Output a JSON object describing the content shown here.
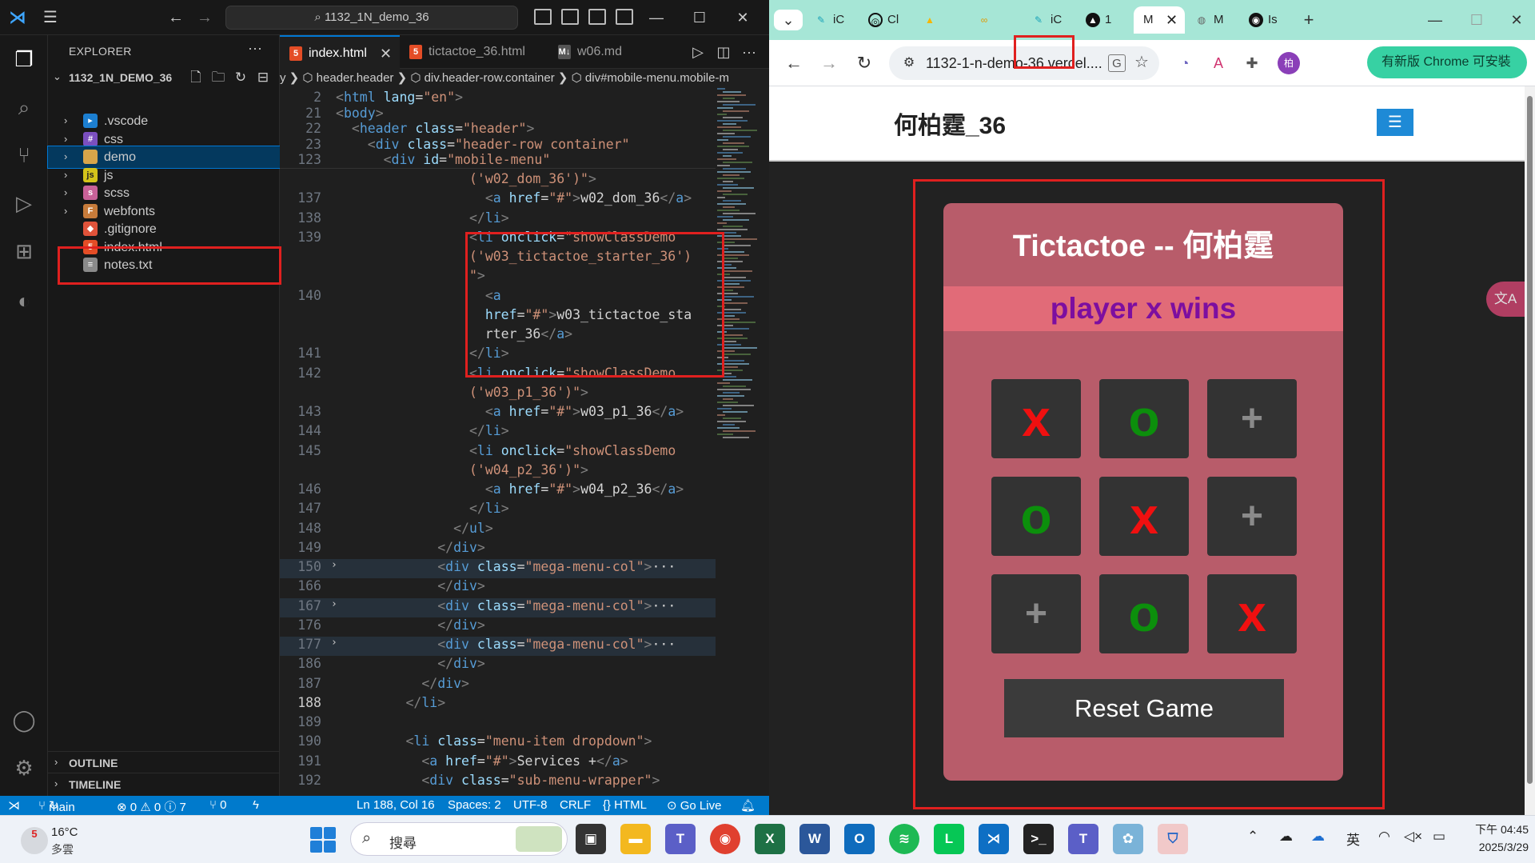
{
  "vscode": {
    "title_search": "1132_1N_demo_36",
    "explorer_label": "EXPLORER",
    "project_name": "1132_1N_DEMO_36",
    "tree": [
      {
        "label": ".vscode",
        "icon": "vscode-folder-icon",
        "folder": true
      },
      {
        "label": "css",
        "icon": "css-folder-icon",
        "folder": true
      },
      {
        "label": "demo",
        "icon": "folder-icon",
        "folder": true,
        "selected": true
      },
      {
        "label": "js",
        "icon": "js-folder-icon",
        "folder": true
      },
      {
        "label": "scss",
        "icon": "scss-folder-icon",
        "folder": true
      },
      {
        "label": "webfonts",
        "icon": "webfonts-folder-icon",
        "folder": true
      },
      {
        "label": ".gitignore",
        "icon": "git-icon",
        "folder": false
      },
      {
        "label": "index.html",
        "icon": "html-file-icon",
        "folder": false
      },
      {
        "label": "notes.txt",
        "icon": "text-file-icon",
        "folder": false
      }
    ],
    "outline_label": "OUTLINE",
    "timeline_label": "TIMELINE",
    "tabs": [
      {
        "label": "index.html",
        "active": true
      },
      {
        "label": "tictactoe_36.html",
        "active": false
      },
      {
        "label": "w06.md",
        "active": false
      }
    ],
    "breadcrumb": "y  ❯  ⬡ header.header  ❯  ⬡ div.header-row.container  ❯  ⬡ div#mobile-menu.mobile-m",
    "sticky_lines": [
      {
        "n": "2",
        "html": "<span class='br'>&lt;</span><span class='tag'>html</span> <span class='att'>lang</span>=<span class='str'>\"en\"</span><span class='br'>&gt;</span>"
      },
      {
        "n": "21",
        "html": "<span class='br'>&lt;</span><span class='tag'>body</span><span class='br'>&gt;</span>"
      },
      {
        "n": "22",
        "html": "  <span class='br'>&lt;</span><span class='tag'>header</span> <span class='att'>class</span>=<span class='str'>\"header\"</span><span class='br'>&gt;</span>"
      },
      {
        "n": "23",
        "html": "    <span class='br'>&lt;</span><span class='tag'>div</span> <span class='att'>class</span>=<span class='str'>\"header-row container\"</span>"
      },
      {
        "n": "123",
        "html": "      <span class='br'>&lt;</span><span class='tag'>div</span> <span class='att'>id</span>=<span class='str'>\"mobile-menu\"</span>"
      }
    ],
    "code_lines": [
      {
        "n": "",
        "html": "                <span class='str'>('w02_dom_36')\"</span><span class='br'>&gt;</span>"
      },
      {
        "n": "137",
        "html": "                  <span class='br'>&lt;</span><span class='tag'>a</span> <span class='att'>href</span>=<span class='str'>\"#\"</span><span class='br'>&gt;</span>w02_dom_36<span class='br'>&lt;/</span><span class='tag'>a</span><span class='br'>&gt;</span>"
      },
      {
        "n": "138",
        "html": "                <span class='br'>&lt;/</span><span class='tag'>li</span><span class='br'>&gt;</span>"
      },
      {
        "n": "139",
        "html": "                <span class='br'>&lt;</span><span class='tag'>li</span> <span class='att'>onclick</span>=<span class='str'>\"showClassDemo</span>"
      },
      {
        "n": "",
        "html": "                <span class='str'>('w03_tictactoe_starter_36')</span>"
      },
      {
        "n": "",
        "html": "                <span class='str'>\"</span><span class='br'>&gt;</span>"
      },
      {
        "n": "140",
        "html": "                  <span class='br'>&lt;</span><span class='tag'>a</span>"
      },
      {
        "n": "",
        "html": "                  <span class='att'>href</span>=<span class='str'>\"#\"</span><span class='br'>&gt;</span>w03_tictactoe_sta"
      },
      {
        "n": "",
        "html": "                  rter_36<span class='br'>&lt;/</span><span class='tag'>a</span><span class='br'>&gt;</span>"
      },
      {
        "n": "141",
        "html": "                <span class='br'>&lt;/</span><span class='tag'>li</span><span class='br'>&gt;</span>"
      },
      {
        "n": "142",
        "html": "                <span class='br'>&lt;</span><span class='tag'>li</span> <span class='att'>onclick</span>=<span class='str'>\"showClassDemo</span>"
      },
      {
        "n": "",
        "html": "                <span class='str'>('w03_p1_36')\"</span><span class='br'>&gt;</span>"
      },
      {
        "n": "143",
        "html": "                  <span class='br'>&lt;</span><span class='tag'>a</span> <span class='att'>href</span>=<span class='str'>\"#\"</span><span class='br'>&gt;</span>w03_p1_36<span class='br'>&lt;/</span><span class='tag'>a</span><span class='br'>&gt;</span>"
      },
      {
        "n": "144",
        "html": "                <span class='br'>&lt;/</span><span class='tag'>li</span><span class='br'>&gt;</span>"
      },
      {
        "n": "145",
        "html": "                <span class='br'>&lt;</span><span class='tag'>li</span> <span class='att'>onclick</span>=<span class='str'>\"showClassDemo</span>"
      },
      {
        "n": "",
        "html": "                <span class='str'>('w04_p2_36')\"</span><span class='br'>&gt;</span>"
      },
      {
        "n": "146",
        "html": "                  <span class='br'>&lt;</span><span class='tag'>a</span> <span class='att'>href</span>=<span class='str'>\"#\"</span><span class='br'>&gt;</span>w04_p2_36<span class='br'>&lt;/</span><span class='tag'>a</span><span class='br'>&gt;</span>"
      },
      {
        "n": "147",
        "html": "                <span class='br'>&lt;/</span><span class='tag'>li</span><span class='br'>&gt;</span>"
      },
      {
        "n": "148",
        "html": "              <span class='br'>&lt;/</span><span class='tag'>ul</span><span class='br'>&gt;</span>"
      },
      {
        "n": "149",
        "html": "            <span class='br'>&lt;/</span><span class='tag'>div</span><span class='br'>&gt;</span>"
      },
      {
        "n": "150",
        "fold": true,
        "html": "            <span class='br'>&lt;</span><span class='tag'>div</span> <span class='att'>class</span>=<span class='str'>\"mega-menu-col\"</span><span class='br'>&gt;</span>···"
      },
      {
        "n": "166",
        "html": "            <span class='br'>&lt;/</span><span class='tag'>div</span><span class='br'>&gt;</span>"
      },
      {
        "n": "167",
        "fold": true,
        "html": "            <span class='br'>&lt;</span><span class='tag'>div</span> <span class='att'>class</span>=<span class='str'>\"mega-menu-col\"</span><span class='br'>&gt;</span>···"
      },
      {
        "n": "176",
        "html": "            <span class='br'>&lt;/</span><span class='tag'>div</span><span class='br'>&gt;</span>"
      },
      {
        "n": "177",
        "fold": true,
        "html": "            <span class='br'>&lt;</span><span class='tag'>div</span> <span class='att'>class</span>=<span class='str'>\"mega-menu-col\"</span><span class='br'>&gt;</span>···"
      },
      {
        "n": "186",
        "html": "            <span class='br'>&lt;/</span><span class='tag'>div</span><span class='br'>&gt;</span>"
      },
      {
        "n": "187",
        "html": "          <span class='br'>&lt;/</span><span class='tag'>div</span><span class='br'>&gt;</span>"
      },
      {
        "n": "188",
        "cur": true,
        "html": "        <span class='br'>&lt;/</span><span class='tag'>li</span><span class='br'>&gt;</span>"
      },
      {
        "n": "189",
        "html": ""
      },
      {
        "n": "190",
        "html": "        <span class='br'>&lt;</span><span class='tag'>li</span> <span class='att'>class</span>=<span class='str'>\"menu-item dropdown\"</span><span class='br'>&gt;</span>"
      },
      {
        "n": "191",
        "html": "          <span class='br'>&lt;</span><span class='tag'>a</span> <span class='att'>href</span>=<span class='str'>\"#\"</span><span class='br'>&gt;</span>Services +<span class='br'>&lt;/</span><span class='tag'>a</span><span class='br'>&gt;</span>"
      },
      {
        "n": "192",
        "html": "          <span class='br'>&lt;</span><span class='tag'>div</span> <span class='att'>class</span>=<span class='str'>\"sub-menu-wrapper\"</span><span class='br'>&gt;</span>"
      }
    ],
    "status": {
      "branch": "main",
      "problems": "⊗ 0 ⚠ 0 ⓘ 7",
      "ports": "⑂ 0",
      "position": "Ln 188, Col 16",
      "spaces": "Spaces: 2",
      "encoding": "UTF-8",
      "eol": "CRLF",
      "language": "{} HTML",
      "golive": "⊙ Go Live"
    }
  },
  "chrome": {
    "tabs": [
      "iC",
      "Cl",
      "",
      "",
      "iC",
      "1",
      "M",
      "M",
      "Is"
    ],
    "url": "1132-1-n-demo-36.vercel....",
    "update_button": "有新版 Chrome 可安裝",
    "site_title": "何柏霆_36",
    "game": {
      "title": "Tictactoe -- 何柏霆",
      "status": "player x wins",
      "board": [
        "x",
        "o",
        "+",
        "o",
        "x",
        "+",
        "+",
        "o",
        "x"
      ],
      "reset_label": "Reset Game"
    },
    "translate_label": "文A"
  },
  "taskbar": {
    "weather_badge": "5",
    "temperature": "16°C",
    "weather_desc": "多雲",
    "search_placeholder": "搜尋",
    "ime": "英",
    "time": "下午 04:45",
    "date": "2025/3/29"
  }
}
